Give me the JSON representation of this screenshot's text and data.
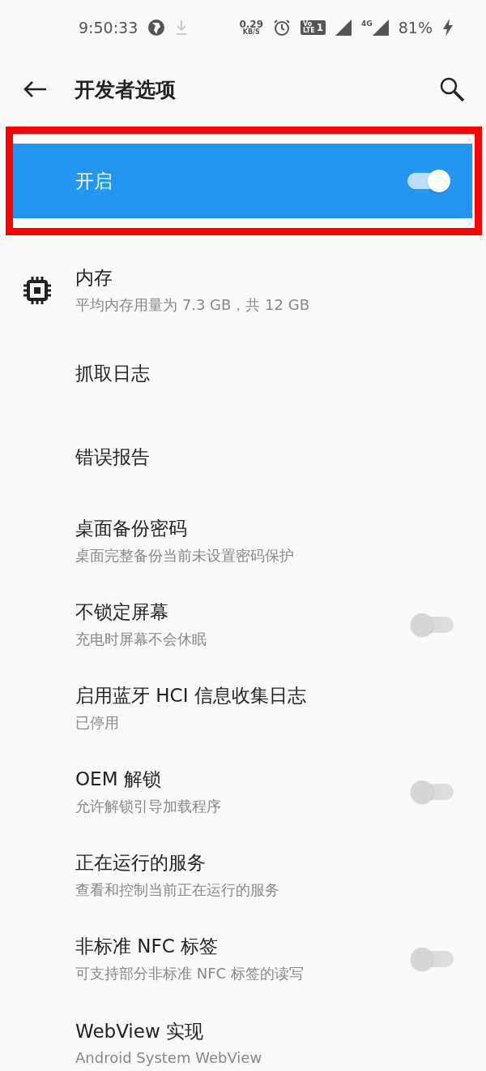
{
  "status_bar": {
    "time": "9:50:33",
    "speed": "0.29",
    "speed_unit": "KB/S",
    "volte": "Vo",
    "volte_lte": "LTE",
    "sim": "1",
    "network": "4G",
    "battery": "81%"
  },
  "header": {
    "title": "开发者选项"
  },
  "master_switch": {
    "label": "开启",
    "on": true,
    "highlighted": true
  },
  "items": [
    {
      "kind": "icon",
      "title": "内存",
      "subtitle": "平均内存用量为 7.3 GB，共 12 GB"
    },
    {
      "kind": "plain",
      "title": "抓取日志"
    },
    {
      "kind": "plain",
      "title": "错误报告"
    },
    {
      "kind": "plain",
      "title": "桌面备份密码",
      "subtitle": "桌面完整备份当前未设置密码保护"
    },
    {
      "kind": "switch",
      "title": "不锁定屏幕",
      "subtitle": "充电时屏幕不会休眠",
      "on": false
    },
    {
      "kind": "plain",
      "title": "启用蓝牙 HCI 信息收集日志",
      "subtitle": "已停用"
    },
    {
      "kind": "switch",
      "title": "OEM 解锁",
      "subtitle": "允许解锁引导加载程序",
      "on": false
    },
    {
      "kind": "plain",
      "title": "正在运行的服务",
      "subtitle": "查看和控制当前正在运行的服务"
    },
    {
      "kind": "switch",
      "title": "非标准 NFC 标签",
      "subtitle": "可支持部分非标准 NFC 标签的读写",
      "on": false
    },
    {
      "kind": "plain",
      "title": "WebView 实现",
      "subtitle": "Android System WebView"
    }
  ]
}
